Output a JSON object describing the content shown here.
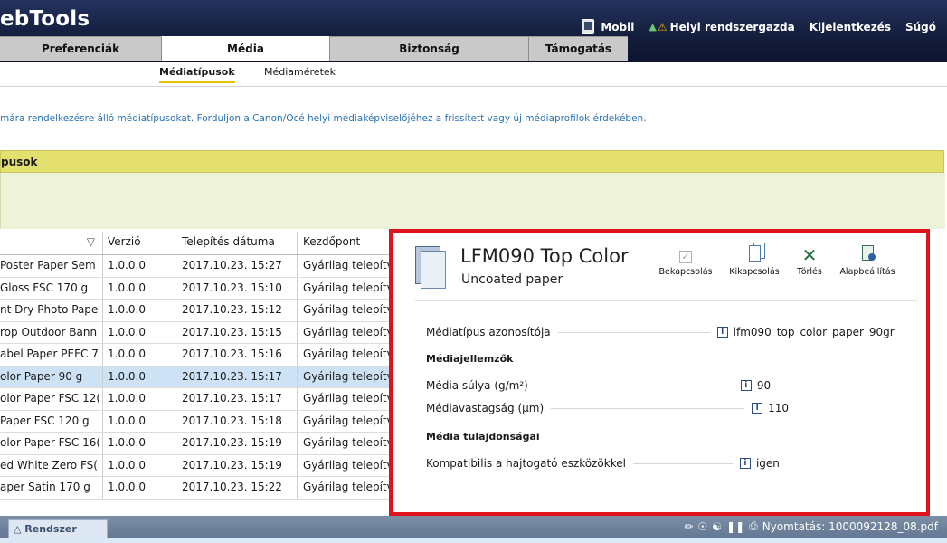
{
  "app_title": "ebTools",
  "top_links": {
    "mobile": "Mobil",
    "admin": "Helyi rendszergazda",
    "logout": "Kijelentkezés",
    "help": "Súgó"
  },
  "tabs": [
    {
      "label": "Preferenciák"
    },
    {
      "label": "Média"
    },
    {
      "label": "Biztonság"
    },
    {
      "label": "Támogatás"
    }
  ],
  "subtabs": [
    {
      "label": "Médiatípusok"
    },
    {
      "label": "Médiaméretek"
    }
  ],
  "info_text": "mára rendelkezésre álló médiatípusokat. Forduljon a Canon/Océ helyi médiaképviselőjéhez a frissített vagy új médiaprofilok érdekében.",
  "panel": {
    "header": "pusok"
  },
  "table": {
    "headers": [
      "▽",
      "Verzió",
      "Telepítés dátuma",
      "Kezdőpont"
    ],
    "rows": [
      [
        "Poster Paper Sem",
        "1.0.0.0",
        "2017.10.23. 15:27",
        "Gyárilag telepítv"
      ],
      [
        "Gloss FSC 170 g",
        "1.0.0.0",
        "2017.10.23. 15:10",
        "Gyárilag telepítv"
      ],
      [
        "nt Dry Photo Pape",
        "1.0.0.0",
        "2017.10.23. 15:12",
        "Gyárilag telepítv"
      ],
      [
        "rop Outdoor Bann",
        "1.0.0.0",
        "2017.10.23. 15:15",
        "Gyárilag telepítv"
      ],
      [
        "abel Paper PEFC 7",
        "1.0.0.0",
        "2017.10.23. 15:16",
        "Gyárilag telepítv"
      ],
      [
        "olor Paper 90 g",
        "1.0.0.0",
        "2017.10.23. 15:17",
        "Gyárilag telepítv"
      ],
      [
        "olor Paper FSC 12(",
        "1.0.0.0",
        "2017.10.23. 15:17",
        "Gyárilag telepítv"
      ],
      [
        "Paper FSC 120 g",
        "1.0.0.0",
        "2017.10.23. 15:18",
        "Gyárilag telepítv"
      ],
      [
        "olor Paper FSC 16(",
        "1.0.0.0",
        "2017.10.23. 15:19",
        "Gyárilag telepítv"
      ],
      [
        "ed White Zero FS(",
        "1.0.0.0",
        "2017.10.23. 15:19",
        "Gyárilag telepítv"
      ],
      [
        "aper Satin 170 g",
        "1.0.0.0",
        "2017.10.23. 15:22",
        "Gyárilag telepítv"
      ]
    ]
  },
  "detail": {
    "title": "LFM090 Top Color",
    "subtitle": "Uncoated paper",
    "actions": {
      "enable": "Bekapcsolás",
      "disable": "Kikapcsolás",
      "delete": "Törlés",
      "default": "Alapbeállítás"
    },
    "media_id_label": "Médiatípus azonosítója",
    "media_id_value": "lfm090_top_color_paper_90gr",
    "characteristics_heading": "Médiajellemzők",
    "weight_label": "Média súlya (g/m²)",
    "weight_value": "90",
    "thickness_label": "Médiavastagság (µm)",
    "thickness_value": "110",
    "properties_heading": "Média tulajdonságai",
    "compatible_label": "Kompatibilis a hajtogató eszközökkel",
    "compatible_value": "igen",
    "info_glyph": "i"
  },
  "statusbar": {
    "system_tab": "△ Rendszer",
    "print_status": "Nyomtatás: 1000092128_08.pdf"
  }
}
